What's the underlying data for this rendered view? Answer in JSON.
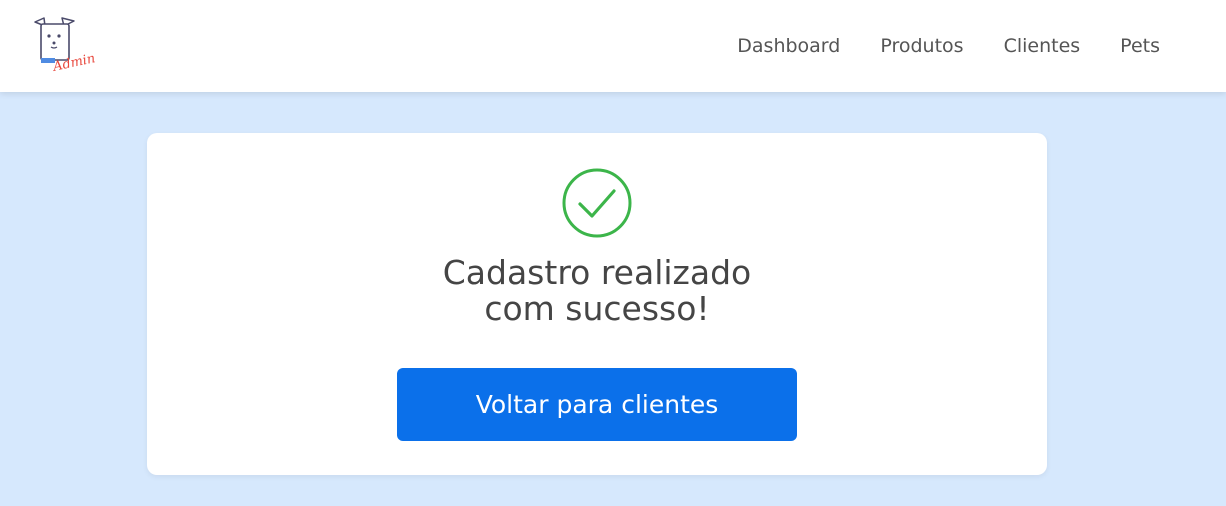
{
  "header": {
    "logo_icon": "dog-admin-logo-icon",
    "logo_text": "Admin",
    "nav": [
      {
        "label": "Dashboard"
      },
      {
        "label": "Produtos"
      },
      {
        "label": "Clientes"
      },
      {
        "label": "Pets"
      }
    ]
  },
  "main": {
    "status_icon": "check-circle-icon",
    "status_color": "#3cb54a",
    "message_line1": "Cadastro realizado",
    "message_line2": "com sucesso!",
    "button_label": "Voltar para clientes",
    "button_color": "#0b70ea"
  },
  "colors": {
    "page_background": "#d6e8fd",
    "accent_red": "#e8473c"
  }
}
